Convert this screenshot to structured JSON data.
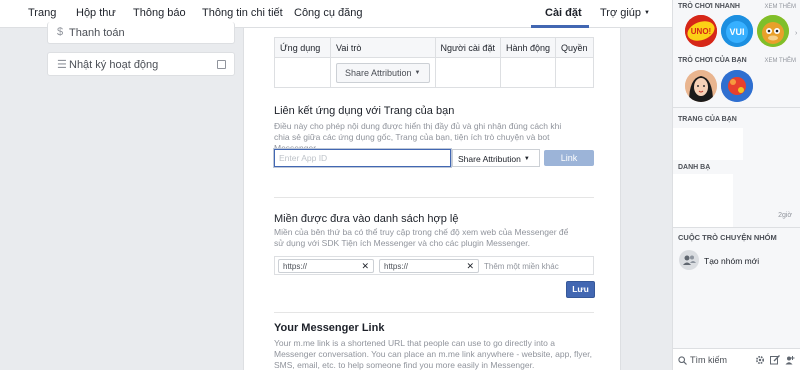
{
  "topnav": {
    "tabs": [
      "Trang",
      "Hộp thư",
      "Thông báo",
      "Thông tin chi tiết",
      "Công cụ đăng",
      "Cài đặt",
      "Trợ giúp"
    ],
    "active_tab": "Cài đặt"
  },
  "sidebar": {
    "items": [
      {
        "label": "Thanh toán",
        "icon": "dollar-icon"
      },
      {
        "label": "Nhật ký hoạt động",
        "icon": "list-icon"
      }
    ]
  },
  "apps_table": {
    "columns": [
      "Ứng dụng",
      "Vai trò",
      "Người cài đặt",
      "Hành động",
      "Quyền"
    ],
    "role_button": "Share Attribution"
  },
  "link_apps": {
    "title": "Liên kết ứng dụng với Trang của bạn",
    "description": "Điều này cho phép nội dung được hiển thị đầy đủ và ghi nhận đúng cách khi chia sẻ giữa các ứng dụng gốc, Trang của bạn, tiện ích trò chuyện và bot Messenger.",
    "appid_placeholder": "Enter App ID",
    "role_select": "Share Attribution",
    "link_button": "Link"
  },
  "whitelist": {
    "title": "Miền được đưa vào danh sách hợp lệ",
    "description": "Miền của bên thứ ba có thể truy cập trong chế độ xem web của Messenger để sử dụng với SDK Tiện ích Messenger và cho các plugin Messenger.",
    "domains": [
      "https://",
      "https://"
    ],
    "add_placeholder": "Thêm một miền khác",
    "save_button": "Lưu"
  },
  "messenger_link": {
    "title": "Your Messenger Link",
    "description": "Your m.me link is a shortened URL that people can use to go directly into a Messenger conversation. You can place an m.me link anywhere - website, app, flyer, SMS, email, etc. to help someone find you more easily in Messenger."
  },
  "chat_sidebar": {
    "quick_games_title": "TRÒ CHƠI NHANH",
    "your_games_title": "TRÒ CHƠI CỦA BẠN",
    "see_more": "XEM THÊM",
    "quick_game_labels": [
      "UNO!",
      "VUI"
    ],
    "your_pages_title": "TRANG CỦA BẠN",
    "contacts_title": "DANH BẠ",
    "contact_time": "2giờ",
    "group_title": "CUỘC TRÒ CHUYỆN NHÓM",
    "create_group": "Tạo nhóm mới",
    "search_placeholder": "Tìm kiếm"
  },
  "colors": {
    "brand": "#4267b2",
    "background": "#e9ebee"
  }
}
